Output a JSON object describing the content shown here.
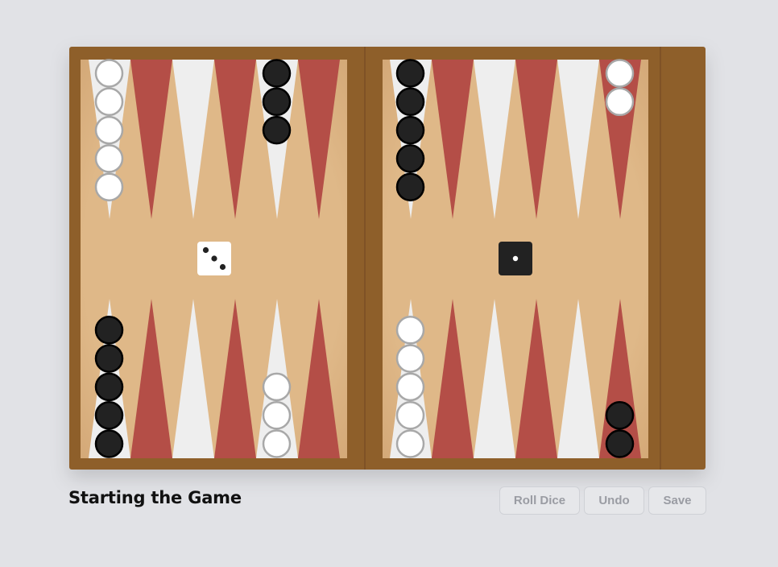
{
  "game": {
    "status_title": "Starting the Game",
    "dice": [
      {
        "value": 3,
        "color": "white"
      },
      {
        "value": 1,
        "color": "black"
      }
    ],
    "points": [
      {
        "point": 1,
        "checkers": {
          "color": "black",
          "count": 2
        }
      },
      {
        "point": 6,
        "checkers": {
          "color": "white",
          "count": 5
        }
      },
      {
        "point": 8,
        "checkers": {
          "color": "white",
          "count": 3
        }
      },
      {
        "point": 12,
        "checkers": {
          "color": "black",
          "count": 5
        }
      },
      {
        "point": 13,
        "checkers": {
          "color": "white",
          "count": 5
        }
      },
      {
        "point": 17,
        "checkers": {
          "color": "black",
          "count": 3
        }
      },
      {
        "point": 19,
        "checkers": {
          "color": "black",
          "count": 5
        }
      },
      {
        "point": 24,
        "checkers": {
          "color": "white",
          "count": 2
        }
      }
    ]
  },
  "controls": {
    "roll_label": "Roll Dice",
    "undo_label": "Undo",
    "save_label": "Save"
  },
  "colors": {
    "page_bg": "#e1e2e6",
    "frame": "#8e5e2c",
    "felt": "#dfb888",
    "triangle_light": "#eeeeee",
    "triangle_dark": "#b44e47",
    "checker_white": "#ffffff",
    "checker_white_border": "#a8a8a8",
    "checker_black": "#222222",
    "checker_black_border": "#000000"
  },
  "icons": {
    "die": "die-icon",
    "checker": "checker-piece"
  }
}
